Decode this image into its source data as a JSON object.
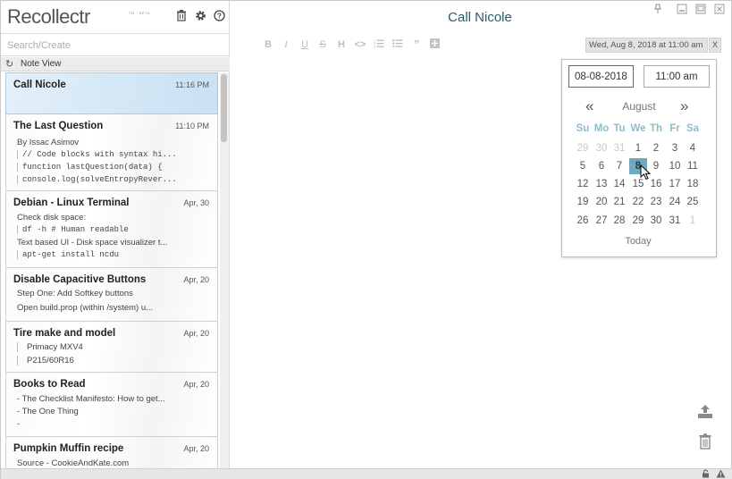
{
  "app": {
    "logo": "Recollectr",
    "logo_badge": "TM · BETA"
  },
  "sidebar": {
    "icons": [
      "trash-icon",
      "gear-icon",
      "help-icon"
    ],
    "search_placeholder": "Search/Create",
    "view_label": "Note View",
    "notes": [
      {
        "title": "Call Nicole",
        "date": "11:16 PM",
        "lines": []
      },
      {
        "title": "The Last Question",
        "date": "11:10 PM",
        "lines": [
          {
            "text": "By Issac Asimov",
            "kind": "text"
          },
          {
            "text": "// Code blocks with syntax hi...",
            "kind": "code"
          },
          {
            "text": "function lastQuestion(data) {",
            "kind": "code"
          },
          {
            "text": "console.log(solveEntropyRever...",
            "kind": "code"
          }
        ]
      },
      {
        "title": "Debian - Linux Terminal",
        "date": "Apr, 30",
        "lines": [
          {
            "text": "Check disk space:",
            "kind": "text"
          },
          {
            "text": "df -h # Human readable",
            "kind": "code"
          },
          {
            "text": "Text based UI - Disk space visualizer t...",
            "kind": "text"
          },
          {
            "text": "apt-get install ncdu",
            "kind": "code"
          }
        ]
      },
      {
        "title": "Disable Capacitive Buttons",
        "date": "Apr, 20",
        "lines": [
          {
            "text": "Step One: Add Softkey buttons",
            "kind": "text"
          },
          {
            "text": "Open build.prop (within /system) u...",
            "kind": "text"
          }
        ]
      },
      {
        "title": "Tire make and model",
        "date": "Apr, 20",
        "lines": [
          {
            "text": "Primacy MXV4",
            "kind": "quote"
          },
          {
            "text": "P215/60R16",
            "kind": "quote"
          }
        ]
      },
      {
        "title": "Books to Read",
        "date": "Apr, 20",
        "lines": [
          {
            "text": "- The Checklist Manifesto: How to get...",
            "kind": "bullet"
          },
          {
            "text": "- The One Thing",
            "kind": "bullet"
          },
          {
            "text": "-",
            "kind": "bullet"
          }
        ]
      },
      {
        "title": "Pumpkin Muffin recipe",
        "date": "Apr, 20",
        "lines": [
          {
            "text": "Source - CookieAndKate.com",
            "kind": "text"
          }
        ]
      }
    ]
  },
  "main": {
    "title": "Call Nicole",
    "toolbar": [
      "B",
      "I",
      "U",
      "S",
      "H",
      "<>",
      "ol",
      "ul",
      "quote",
      "add"
    ],
    "reminder": "Wed, Aug 8, 2018 at 11:00 am",
    "reminder_close": "X"
  },
  "picker": {
    "date_value": "08-08-2018",
    "time_value": "11:00 am",
    "prev": "«",
    "next": "»",
    "month": "August",
    "weekdays": [
      "Su",
      "Mo",
      "Tu",
      "We",
      "Th",
      "Fr",
      "Sa"
    ],
    "weeks": [
      [
        "29",
        "30",
        "31",
        "1",
        "2",
        "3",
        "4"
      ],
      [
        "5",
        "6",
        "7",
        "8",
        "9",
        "10",
        "11"
      ],
      [
        "12",
        "13",
        "14",
        "15",
        "16",
        "17",
        "18"
      ],
      [
        "19",
        "20",
        "21",
        "22",
        "23",
        "24",
        "25"
      ],
      [
        "26",
        "27",
        "28",
        "29",
        "30",
        "31",
        "1"
      ]
    ],
    "selected": "8",
    "today_label": "Today"
  },
  "colors": {
    "accent": "#2a5d6a",
    "selected_day": "#6fa9bf",
    "weekday": "#8fbccb",
    "active_note": "#d5e8f6"
  }
}
